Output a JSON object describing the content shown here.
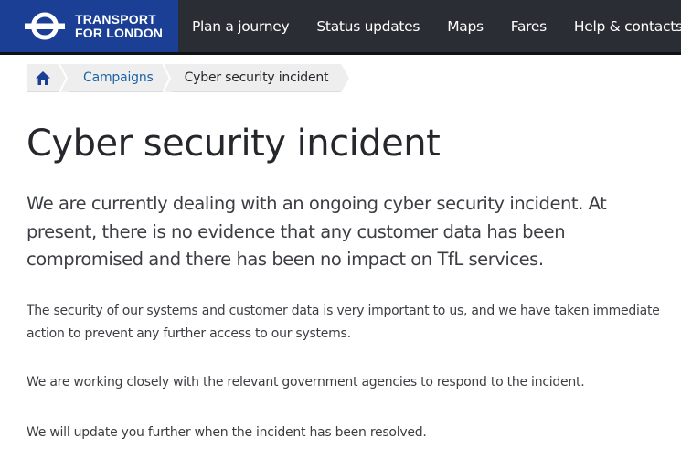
{
  "header": {
    "brand": {
      "line1": "TRANSPORT",
      "line2": "FOR LONDON",
      "logo_icon": "tfl-roundel-icon",
      "color": "#1b3f94"
    },
    "nav": [
      {
        "label": "Plan a journey"
      },
      {
        "label": "Status updates"
      },
      {
        "label": "Maps"
      },
      {
        "label": "Fares"
      },
      {
        "label": "Help & contacts"
      }
    ],
    "background": "#2a2d34"
  },
  "breadcrumb": {
    "home_icon": "home-icon",
    "items": [
      {
        "label": "Campaigns",
        "link": true
      },
      {
        "label": "Cyber security incident",
        "link": false
      }
    ],
    "link_color": "#1c63a8"
  },
  "page": {
    "title": "Cyber security incident",
    "lead": "We are currently dealing with an ongoing cyber security incident. At present, there is no evidence that any customer data has been compromised and there has been no impact on TfL services.",
    "paragraphs": [
      "The security of our systems and customer data is very important to us, and we have taken immediate action to prevent any further access to our systems.",
      "We are working closely with the relevant government agencies to respond to the incident.",
      "We will update you further when the incident has been resolved."
    ]
  }
}
